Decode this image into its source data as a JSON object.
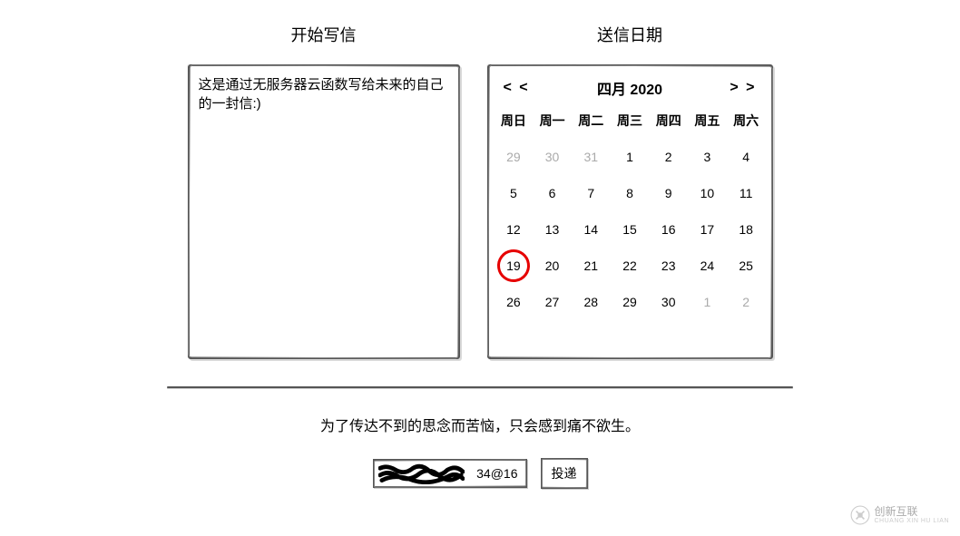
{
  "letter": {
    "title": "开始写信",
    "content": "这是通过无服务器云函数写给未来的自己的一封信:)"
  },
  "calendar": {
    "title": "送信日期",
    "month_label": "四月 2020",
    "prev": "< <",
    "next": "> >",
    "dow": [
      "周日",
      "周一",
      "周二",
      "周三",
      "周四",
      "周五",
      "周六"
    ],
    "today": 19,
    "cells": [
      {
        "n": 29,
        "muted": true
      },
      {
        "n": 30,
        "muted": true
      },
      {
        "n": 31,
        "muted": true
      },
      {
        "n": 1
      },
      {
        "n": 2
      },
      {
        "n": 3
      },
      {
        "n": 4
      },
      {
        "n": 5
      },
      {
        "n": 6
      },
      {
        "n": 7
      },
      {
        "n": 8
      },
      {
        "n": 9
      },
      {
        "n": 10
      },
      {
        "n": 11
      },
      {
        "n": 12
      },
      {
        "n": 13
      },
      {
        "n": 14
      },
      {
        "n": 15
      },
      {
        "n": 16
      },
      {
        "n": 17
      },
      {
        "n": 18
      },
      {
        "n": 19
      },
      {
        "n": 20
      },
      {
        "n": 21
      },
      {
        "n": 22
      },
      {
        "n": 23
      },
      {
        "n": 24
      },
      {
        "n": 25
      },
      {
        "n": 26
      },
      {
        "n": 27
      },
      {
        "n": 28
      },
      {
        "n": 29
      },
      {
        "n": 30
      },
      {
        "n": 1,
        "muted": true
      },
      {
        "n": 2,
        "muted": true
      }
    ]
  },
  "footer": {
    "text": "为了传达不到的思念而苦恼，只会感到痛不欲生。",
    "email_visible": "34@16",
    "send_label": "投递"
  },
  "watermark": {
    "cn": "创新互联",
    "en": "CHUANG XIN HU LIAN"
  }
}
